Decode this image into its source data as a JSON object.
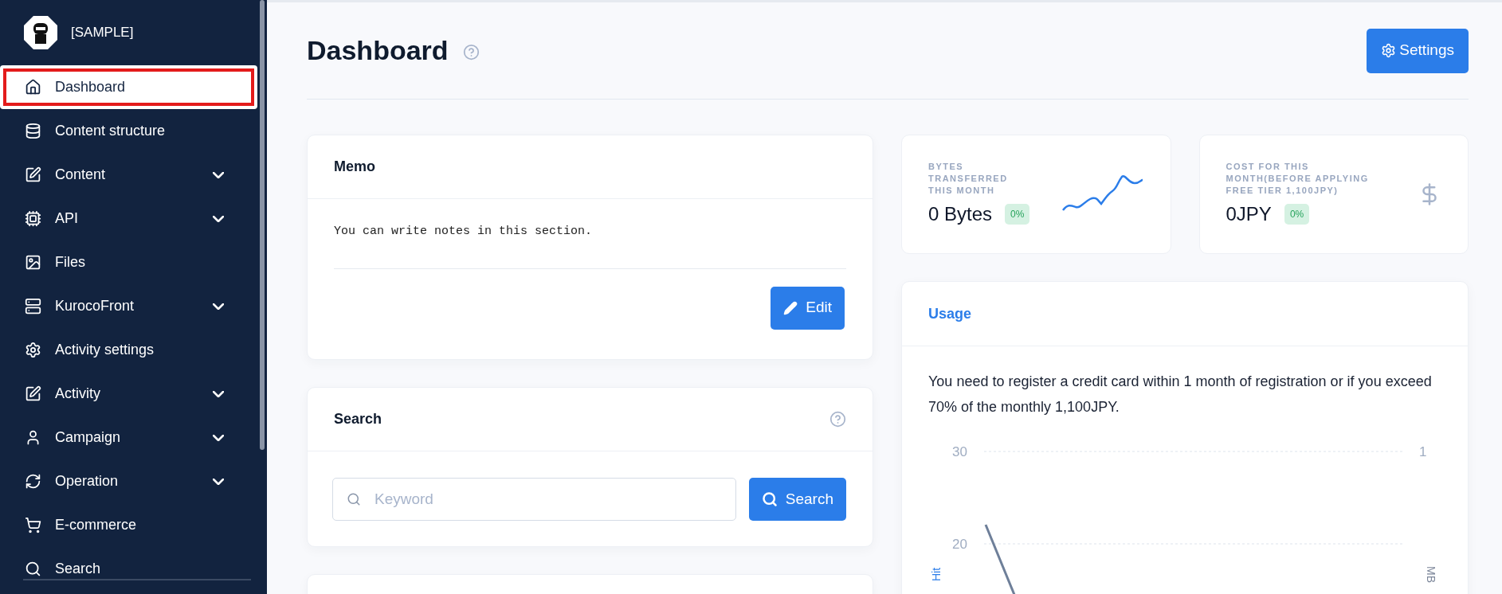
{
  "sidebar": {
    "project_name": "[SAMPLE]",
    "items": [
      {
        "label": "Dashboard",
        "selected": true,
        "highlighted": true,
        "expandable": false
      },
      {
        "label": "Content structure",
        "selected": false,
        "highlighted": false,
        "expandable": false
      },
      {
        "label": "Content",
        "selected": false,
        "highlighted": false,
        "expandable": true
      },
      {
        "label": "API",
        "selected": false,
        "highlighted": false,
        "expandable": true
      },
      {
        "label": "Files",
        "selected": false,
        "highlighted": false,
        "expandable": false
      },
      {
        "label": "KurocoFront",
        "selected": false,
        "highlighted": false,
        "expandable": true
      },
      {
        "label": "Activity settings",
        "selected": false,
        "highlighted": false,
        "expandable": false
      },
      {
        "label": "Activity",
        "selected": false,
        "highlighted": false,
        "expandable": true
      },
      {
        "label": "Campaign",
        "selected": false,
        "highlighted": false,
        "expandable": true
      },
      {
        "label": "Operation",
        "selected": false,
        "highlighted": false,
        "expandable": true
      },
      {
        "label": "E-commerce",
        "selected": false,
        "highlighted": false,
        "expandable": false
      },
      {
        "label": "Search",
        "selected": false,
        "highlighted": false,
        "expandable": false
      }
    ]
  },
  "header": {
    "title": "Dashboard",
    "settings_button": "Settings"
  },
  "memo": {
    "title": "Memo",
    "text": "You can write notes in this section.",
    "edit_button": "Edit"
  },
  "search": {
    "title": "Search",
    "placeholder": "Keyword",
    "button": "Search"
  },
  "stats": [
    {
      "label": "BYTES TRANSFERRED THIS MONTH",
      "value": "0 Bytes",
      "change": "0%",
      "kind": "sparkline"
    },
    {
      "label": "COST FOR THIS MONTH(BEFORE APPLYING FREE TIER 1,100JPY)",
      "value": "0JPY",
      "change": "0%",
      "kind": "dollar"
    }
  ],
  "usage": {
    "title": "Usage",
    "notice": "You need to register a credit card within 1 month of registration or if you exceed 70% of the monthly 1,100JPY.",
    "chart": {
      "left_ticks": [
        "30",
        "20"
      ],
      "right_ticks": [
        "1"
      ],
      "left_axis_label": "Hit",
      "right_axis_label": "MB"
    }
  }
}
